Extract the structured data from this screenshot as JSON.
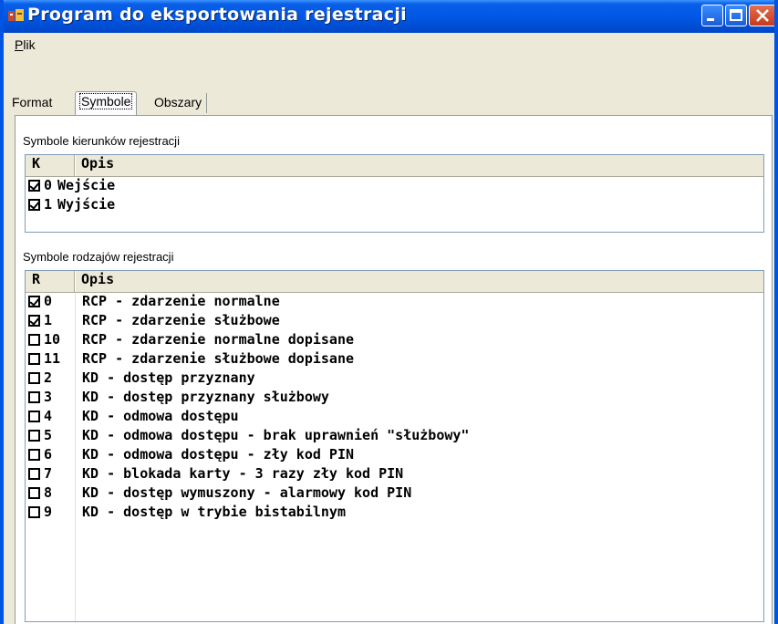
{
  "window": {
    "title": "Program do eksportowania rejestracji"
  },
  "menu": {
    "plik": "Plik"
  },
  "tabs": [
    {
      "label": "Format"
    },
    {
      "label": "Symbole",
      "active": true
    },
    {
      "label": "Obszary"
    }
  ],
  "directions": {
    "group_label": "Symbole kierunków rejestracji",
    "columns": [
      "K",
      "Opis"
    ],
    "rows": [
      {
        "checked": true,
        "code": "0",
        "desc": "Wejście"
      },
      {
        "checked": true,
        "code": "1",
        "desc": "Wyjście"
      }
    ]
  },
  "types": {
    "group_label": "Symbole rodzajów rejestracji",
    "columns": [
      "R",
      "Opis"
    ],
    "rows": [
      {
        "checked": true,
        "code": "0",
        "desc": "RCP - zdarzenie normalne"
      },
      {
        "checked": true,
        "code": "1",
        "desc": "RCP - zdarzenie służbowe"
      },
      {
        "checked": false,
        "code": "10",
        "desc": "RCP - zdarzenie normalne dopisane"
      },
      {
        "checked": false,
        "code": "11",
        "desc": "RCP - zdarzenie służbowe dopisane"
      },
      {
        "checked": false,
        "code": "2",
        "desc": "KD - dostęp przyznany"
      },
      {
        "checked": false,
        "code": "3",
        "desc": "KD - dostęp przyznany służbowy"
      },
      {
        "checked": false,
        "code": "4",
        "desc": "KD - odmowa dostępu"
      },
      {
        "checked": false,
        "code": "5",
        "desc": "KD - odmowa dostępu - brak uprawnień \"służbowy\""
      },
      {
        "checked": false,
        "code": "6",
        "desc": "KD - odmowa dostępu - zły kod PIN"
      },
      {
        "checked": false,
        "code": "7",
        "desc": "KD - blokada karty - 3 razy zły kod PIN"
      },
      {
        "checked": false,
        "code": "8",
        "desc": "KD - dostęp wymuszony - alarmowy kod PIN"
      },
      {
        "checked": false,
        "code": "9",
        "desc": "KD - dostęp w trybie bistabilnym"
      }
    ]
  },
  "colors": {
    "titlebar": "#0058e6",
    "face": "#ece9d8",
    "grid_border": "#7f9db9"
  }
}
